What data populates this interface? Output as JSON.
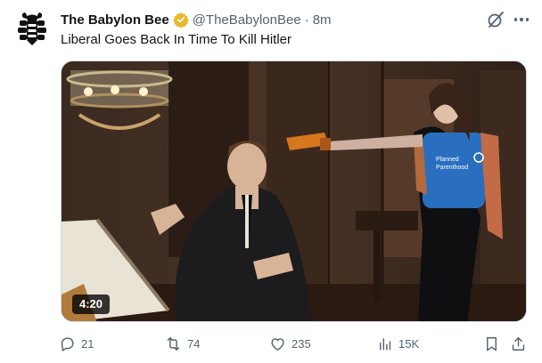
{
  "tweet": {
    "author_name": "The Babylon Bee",
    "handle": "@TheBabylonBee",
    "separator": "·",
    "time": "8m",
    "text": "Liberal Goes Back In Time To Kill Hitler",
    "verified_color": "#E8B82A"
  },
  "media": {
    "duration": "4:20",
    "shirt_text": [
      "Planned",
      "Parenthood"
    ]
  },
  "actions": {
    "replies": "21",
    "reposts": "74",
    "likes": "235",
    "views": "15K"
  },
  "icons": {
    "avatar": "babylon-bee-logo",
    "verified": "verified-badge-icon",
    "grok": "grok-icon",
    "more": "more-icon",
    "reply": "reply-icon",
    "repost": "repost-icon",
    "like": "like-icon",
    "views": "views-icon",
    "bookmark": "bookmark-icon",
    "share": "share-icon"
  },
  "colors": {
    "text": "#0f1419",
    "secondary": "#536471",
    "border": "#cfd9de"
  }
}
